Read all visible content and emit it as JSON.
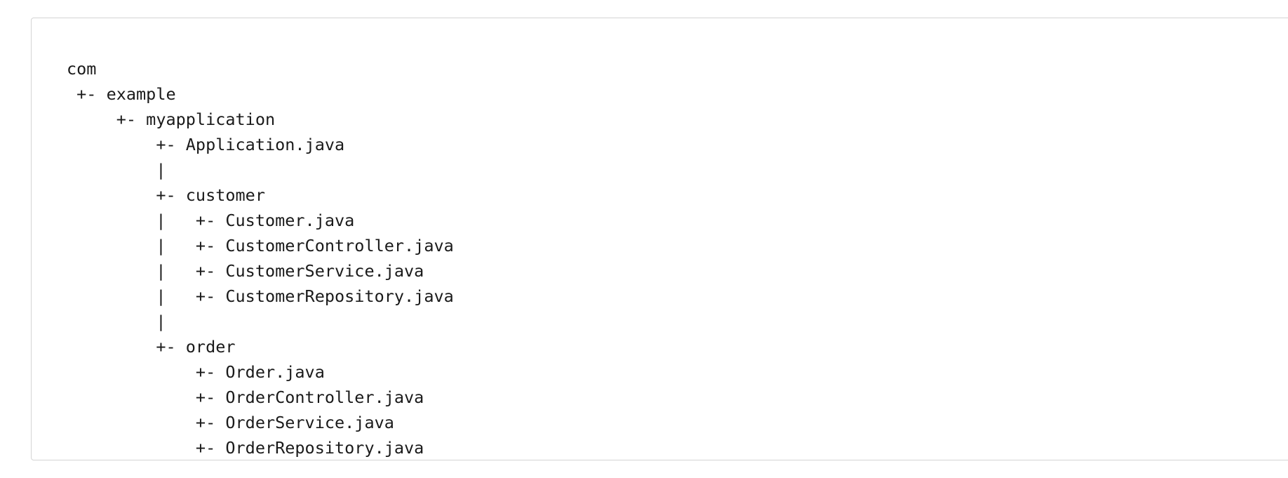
{
  "code_block": {
    "lines": [
      "com",
      " +- example",
      "     +- myapplication",
      "         +- Application.java",
      "         |",
      "         +- customer",
      "         |   +- Customer.java",
      "         |   +- CustomerController.java",
      "         |   +- CustomerService.java",
      "         |   +- CustomerRepository.java",
      "         |",
      "         +- order",
      "             +- Order.java",
      "             +- OrderController.java",
      "             +- OrderService.java",
      "             +- OrderRepository.java"
    ]
  }
}
